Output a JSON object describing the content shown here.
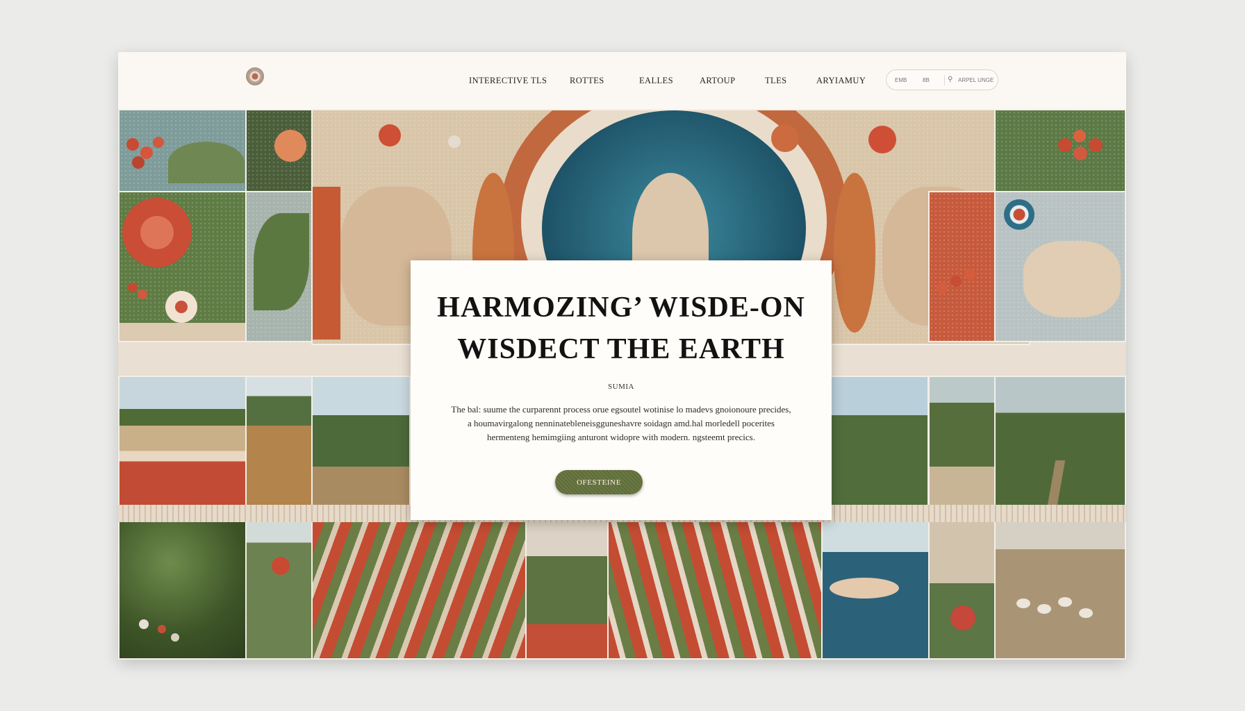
{
  "header": {
    "nav": [
      "INTERECTIVE TLS",
      "ROTTES",
      "EALLES",
      "ARTOUP",
      "TLES",
      "ARYIAMUY"
    ],
    "search": {
      "left": "EMB",
      "mid": "8B",
      "right": "ARPEL UNGE"
    }
  },
  "hero": {
    "title_line1": "HARMOZING’ WISDE-ON",
    "title_line2": "WISDECT THE EARTH",
    "subtitle": "SUMIA",
    "body_line1": "The bal: suume the curparennt process orue egsoutel wotinise lo madevs gnoionoure precides,",
    "body_line2": "a houmavirgalong nenninatebleneisgguneshavre soidagn amd.hal morledell pocerites",
    "body_line3": "hermenteng hemimgiing anturont widopre with modern. ngsteemt precics.",
    "button_label": "OFESTEINE"
  },
  "colors": {
    "page_bg": "#ebebea",
    "card_bg": "#fffdf9",
    "terracotta": "#c4563c",
    "sage": "#6b7f4a",
    "teal": "#2f6e83",
    "sand": "#d8c4a6",
    "button": "#5f6c3b"
  },
  "icons": {
    "logo": "mosaic-emblem-icon"
  }
}
